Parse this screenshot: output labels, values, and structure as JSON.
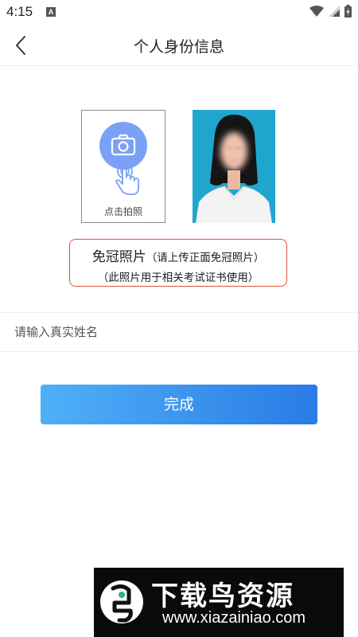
{
  "status_bar": {
    "time": "4:15",
    "app_icon_letter": "A"
  },
  "header": {
    "title": "个人身份信息"
  },
  "photo": {
    "upload_label": "点击拍照"
  },
  "notice": {
    "main": "免冠照片",
    "hint": "（请上传正面免冠照片）",
    "usage": "（此照片用于相关考试证书使用）"
  },
  "name_field": {
    "placeholder": "请输入真实姓名",
    "value": ""
  },
  "submit": {
    "label": "完成"
  },
  "watermark": {
    "title": "下载鸟资源",
    "url": "www.xiazainiao.com"
  },
  "colors": {
    "accent_blue": "#2a7be6",
    "button_gradient_start": "#4fb0f7",
    "camera_circle": "#7aa1f5",
    "notice_border": "#e0523b",
    "photo_background": "#1fa6cf"
  },
  "icons": {
    "back": "chevron-left-icon",
    "camera": "camera-icon",
    "tap": "tap-hand-icon",
    "wifi": "wifi-icon",
    "signal": "signal-icon",
    "battery": "battery-icon"
  }
}
